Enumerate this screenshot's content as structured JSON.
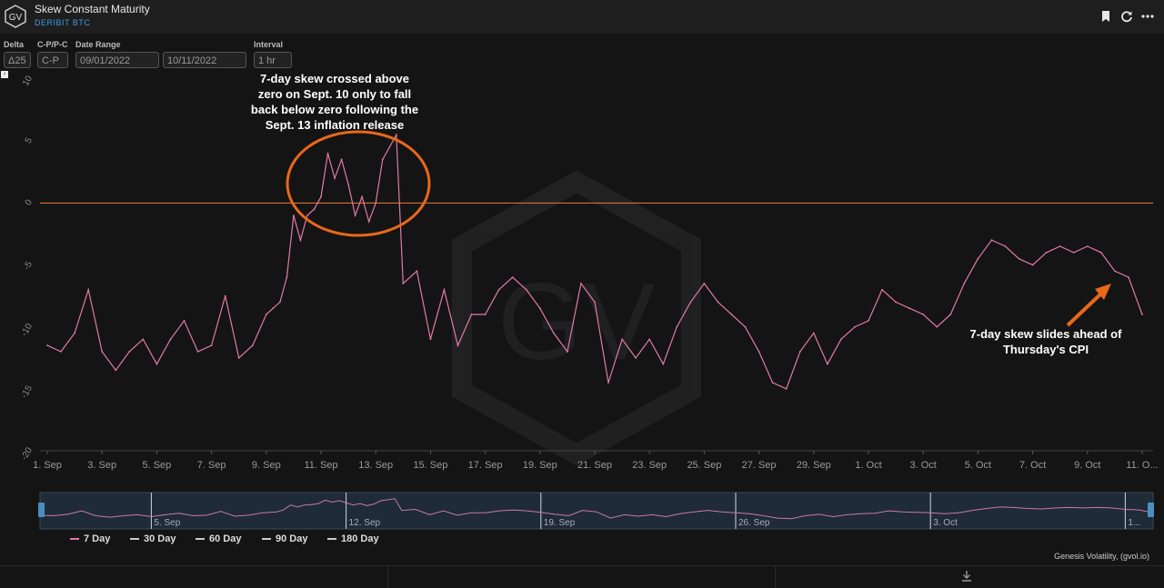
{
  "header": {
    "title": "Skew Constant Maturity",
    "subtitle": "DERIBIT BTC",
    "logo_text": "GV",
    "icons": [
      "bookmark-icon",
      "refresh-icon",
      "more-icon"
    ]
  },
  "controls": {
    "delta_label": "Delta",
    "delta_value": "Δ25",
    "cp_label": "C-P/P-C",
    "cp_value": "C-P",
    "range_label": "Date Range",
    "start_date": "09/01/2022",
    "end_date": "10/11/2022",
    "interval_label": "Interval",
    "interval_value": "1 hr",
    "expand_glyph": "›"
  },
  "watermark": "GV",
  "colors": {
    "series": "#e07aa8",
    "zero_line": "#f07a3a",
    "annotation": "#e8681a",
    "background": "#141414"
  },
  "chart_data": {
    "type": "line",
    "title": "Skew Constant Maturity",
    "ylim": [
      -20,
      10
    ],
    "yticks": [
      "-20",
      "-15",
      "-10",
      "-5",
      "0",
      "5",
      "10"
    ],
    "xticks": [
      "1. Sep",
      "3. Sep",
      "5. Sep",
      "7. Sep",
      "9. Sep",
      "11. Sep",
      "13. Sep",
      "15. Sep",
      "17. Sep",
      "19. Sep",
      "21. Sep",
      "23. Sep",
      "25. Sep",
      "27. Sep",
      "29. Sep",
      "1. Oct",
      "3. Oct",
      "5. Oct",
      "7. Oct",
      "9. Oct",
      "11. O..."
    ],
    "reference_line": 0,
    "grid": false,
    "series": [
      {
        "name": "7 Day",
        "x": [
          "2022-09-01",
          "2022-09-01T12",
          "2022-09-02",
          "2022-09-02T12",
          "2022-09-03",
          "2022-09-03T12",
          "2022-09-04",
          "2022-09-04T12",
          "2022-09-05",
          "2022-09-05T12",
          "2022-09-06",
          "2022-09-06T12",
          "2022-09-07",
          "2022-09-07T12",
          "2022-09-08",
          "2022-09-08T12",
          "2022-09-09",
          "2022-09-09T06",
          "2022-09-09T12",
          "2022-09-09T18",
          "2022-09-10",
          "2022-09-10T06",
          "2022-09-10T12",
          "2022-09-10T18",
          "2022-09-11",
          "2022-09-11T06",
          "2022-09-11T12",
          "2022-09-11T18",
          "2022-09-12",
          "2022-09-12T06",
          "2022-09-12T12",
          "2022-09-12T18",
          "2022-09-13",
          "2022-09-13T06",
          "2022-09-13T12",
          "2022-09-13T18",
          "2022-09-14",
          "2022-09-14T12",
          "2022-09-15",
          "2022-09-15T12",
          "2022-09-16",
          "2022-09-16T12",
          "2022-09-17",
          "2022-09-17T12",
          "2022-09-18",
          "2022-09-18T12",
          "2022-09-19",
          "2022-09-19T12",
          "2022-09-20",
          "2022-09-20T12",
          "2022-09-21",
          "2022-09-21T12",
          "2022-09-22",
          "2022-09-22T12",
          "2022-09-23",
          "2022-09-23T12",
          "2022-09-24",
          "2022-09-24T12",
          "2022-09-25",
          "2022-09-25T12",
          "2022-09-26",
          "2022-09-26T12",
          "2022-09-27",
          "2022-09-27T12",
          "2022-09-28",
          "2022-09-28T12",
          "2022-09-29",
          "2022-09-29T12",
          "2022-09-30",
          "2022-09-30T12",
          "2022-10-01",
          "2022-10-01T12",
          "2022-10-02",
          "2022-10-02T12",
          "2022-10-03",
          "2022-10-03T12",
          "2022-10-04",
          "2022-10-04T12",
          "2022-10-05",
          "2022-10-05T12",
          "2022-10-06",
          "2022-10-06T12",
          "2022-10-07",
          "2022-10-07T12",
          "2022-10-08",
          "2022-10-08T12",
          "2022-10-09",
          "2022-10-09T12",
          "2022-10-10",
          "2022-10-10T12",
          "2022-10-11"
        ],
        "y": [
          -11.5,
          -12.0,
          -10.5,
          -7.0,
          -12.0,
          -13.5,
          -12.0,
          -11.0,
          -13.0,
          -11.0,
          -9.5,
          -12.0,
          -11.5,
          -7.5,
          -12.5,
          -11.5,
          -9.0,
          -8.5,
          -8.0,
          -6.0,
          -1.0,
          -3.0,
          -1.0,
          -0.5,
          0.5,
          4.0,
          2.0,
          3.5,
          1.5,
          -1.0,
          0.5,
          -1.5,
          0.0,
          3.5,
          4.5,
          5.5,
          -6.5,
          -5.5,
          -11.0,
          -7.0,
          -11.5,
          -9.0,
          -9.0,
          -7.0,
          -6.0,
          -7.0,
          -8.5,
          -10.5,
          -12.0,
          -6.5,
          -8.0,
          -14.5,
          -11.0,
          -12.5,
          -11.0,
          -13.0,
          -10.0,
          -8.0,
          -6.5,
          -8.0,
          -9.0,
          -10.0,
          -12.0,
          -14.5,
          -15.0,
          -12.0,
          -10.5,
          -13.0,
          -11.0,
          -10.0,
          -9.5,
          -7.0,
          -8.0,
          -8.5,
          -9.0,
          -10.0,
          -9.0,
          -6.5,
          -4.5,
          -3.0,
          -3.5,
          -4.5,
          -5.0,
          -4.0,
          -3.5,
          -4.0,
          -3.5,
          -4.0,
          -5.5,
          -6.0,
          -9.0
        ]
      },
      {
        "name": "30 Day"
      },
      {
        "name": "60 Day"
      },
      {
        "name": "90 Day"
      },
      {
        "name": "180 Day"
      }
    ],
    "navigator_ticks": [
      "5. Sep",
      "12. Sep",
      "19. Sep",
      "26. Sep",
      "3. Oct",
      "1..."
    ]
  },
  "annotations": {
    "top": [
      "7-day skew crossed above",
      "zero on Sept. 10 only to fall",
      "back below zero following the",
      "Sept. 13 inflation release"
    ],
    "right": [
      "7-day skew slides ahead of",
      "Thursday's CPI"
    ]
  },
  "legend": [
    {
      "label": "7 Day",
      "color": "#e07aa8"
    },
    {
      "label": "30 Day",
      "color": "#cccccc"
    },
    {
      "label": "60 Day",
      "color": "#cccccc"
    },
    {
      "label": "90 Day",
      "color": "#cccccc"
    },
    {
      "label": "180 Day",
      "color": "#cccccc"
    }
  ],
  "credit": "Genesis Volatility, (gvol.io)",
  "footer": {
    "download_icon": "download-icon"
  }
}
